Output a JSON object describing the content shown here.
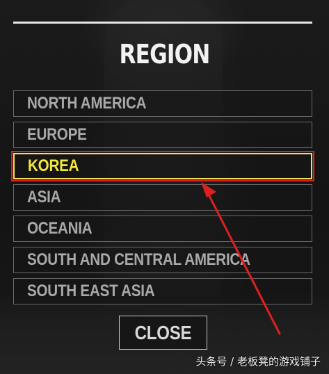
{
  "dialog": {
    "title": "REGION",
    "regions": [
      {
        "label": "NORTH AMERICA",
        "selected": false
      },
      {
        "label": "EUROPE",
        "selected": false
      },
      {
        "label": "KOREA",
        "selected": true
      },
      {
        "label": "ASIA",
        "selected": false
      },
      {
        "label": "OCEANIA",
        "selected": false
      },
      {
        "label": "SOUTH AND CENTRAL AMERICA",
        "selected": false
      },
      {
        "label": "SOUTH EAST ASIA",
        "selected": false
      }
    ],
    "close_label": "CLOSE"
  },
  "annotation": {
    "highlight_color": "#e02020",
    "selected_text_color": "#f5e83a"
  },
  "watermark": "头条号 / 老板凳的游戏铺子"
}
